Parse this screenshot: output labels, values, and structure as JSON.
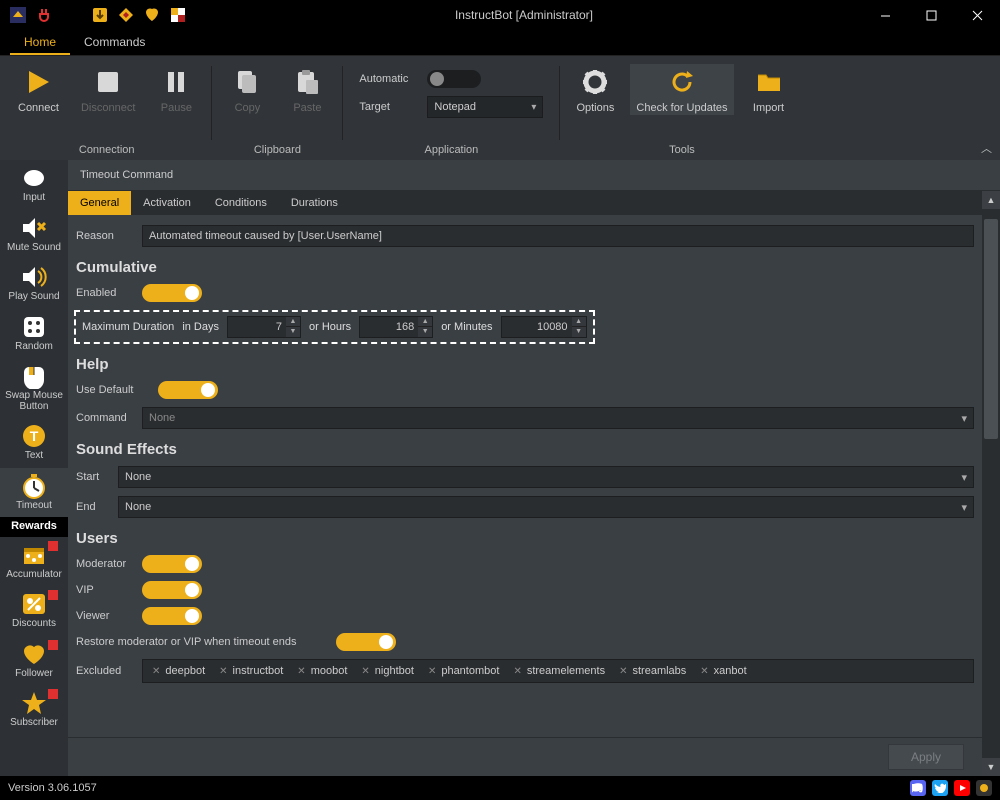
{
  "window": {
    "title": "InstructBot [Administrator]"
  },
  "maintabs": {
    "home": "Home",
    "commands": "Commands"
  },
  "ribbon": {
    "connection": {
      "label": "Connection",
      "connect": "Connect",
      "disconnect": "Disconnect",
      "pause": "Pause"
    },
    "clipboard": {
      "label": "Clipboard",
      "copy": "Copy",
      "paste": "Paste"
    },
    "application": {
      "label": "Application",
      "automatic": "Automatic",
      "target": "Target",
      "target_value": "Notepad"
    },
    "tools": {
      "label": "Tools",
      "options": "Options",
      "check": "Check for Updates",
      "import": "Import"
    }
  },
  "sidebar": [
    {
      "id": "input",
      "label": "Input"
    },
    {
      "id": "mute-sound",
      "label": "Mute Sound"
    },
    {
      "id": "play-sound",
      "label": "Play Sound"
    },
    {
      "id": "random",
      "label": "Random"
    },
    {
      "id": "swap-mouse",
      "label": "Swap Mouse Button"
    },
    {
      "id": "text",
      "label": "Text"
    },
    {
      "id": "timeout",
      "label": "Timeout"
    }
  ],
  "rewards_label": "Rewards",
  "rewards": [
    {
      "id": "accumulator",
      "label": "Accumulator"
    },
    {
      "id": "discounts",
      "label": "Discounts"
    },
    {
      "id": "follower",
      "label": "Follower"
    },
    {
      "id": "subscriber",
      "label": "Subscriber"
    }
  ],
  "content": {
    "header": "Timeout Command",
    "tabs": {
      "general": "General",
      "activation": "Activation",
      "conditions": "Conditions",
      "durations": "Durations"
    },
    "reason_label": "Reason",
    "reason_value": "Automated timeout caused by [User.UserName]",
    "cumulative": {
      "title": "Cumulative",
      "enabled": "Enabled",
      "max_duration": "Maximum Duration",
      "in_days": "in Days",
      "days_val": "7",
      "or_hours": "or Hours",
      "hours_val": "168",
      "or_minutes": "or Minutes",
      "minutes_val": "10080"
    },
    "help": {
      "title": "Help",
      "use_default": "Use Default",
      "command": "Command",
      "command_value": "None"
    },
    "sound": {
      "title": "Sound Effects",
      "start": "Start",
      "start_value": "None",
      "end": "End",
      "end_value": "None"
    },
    "users": {
      "title": "Users",
      "moderator": "Moderator",
      "vip": "VIP",
      "viewer": "Viewer",
      "restore": "Restore moderator or VIP when timeout ends",
      "excluded": "Excluded",
      "chips": [
        "deepbot",
        "instructbot",
        "moobot",
        "nightbot",
        "phantombot",
        "streamelements",
        "streamlabs",
        "xanbot"
      ]
    },
    "apply": "Apply"
  },
  "status": {
    "version": "Version 3.06.1057"
  },
  "colors": {
    "accent": "#edb01a"
  }
}
